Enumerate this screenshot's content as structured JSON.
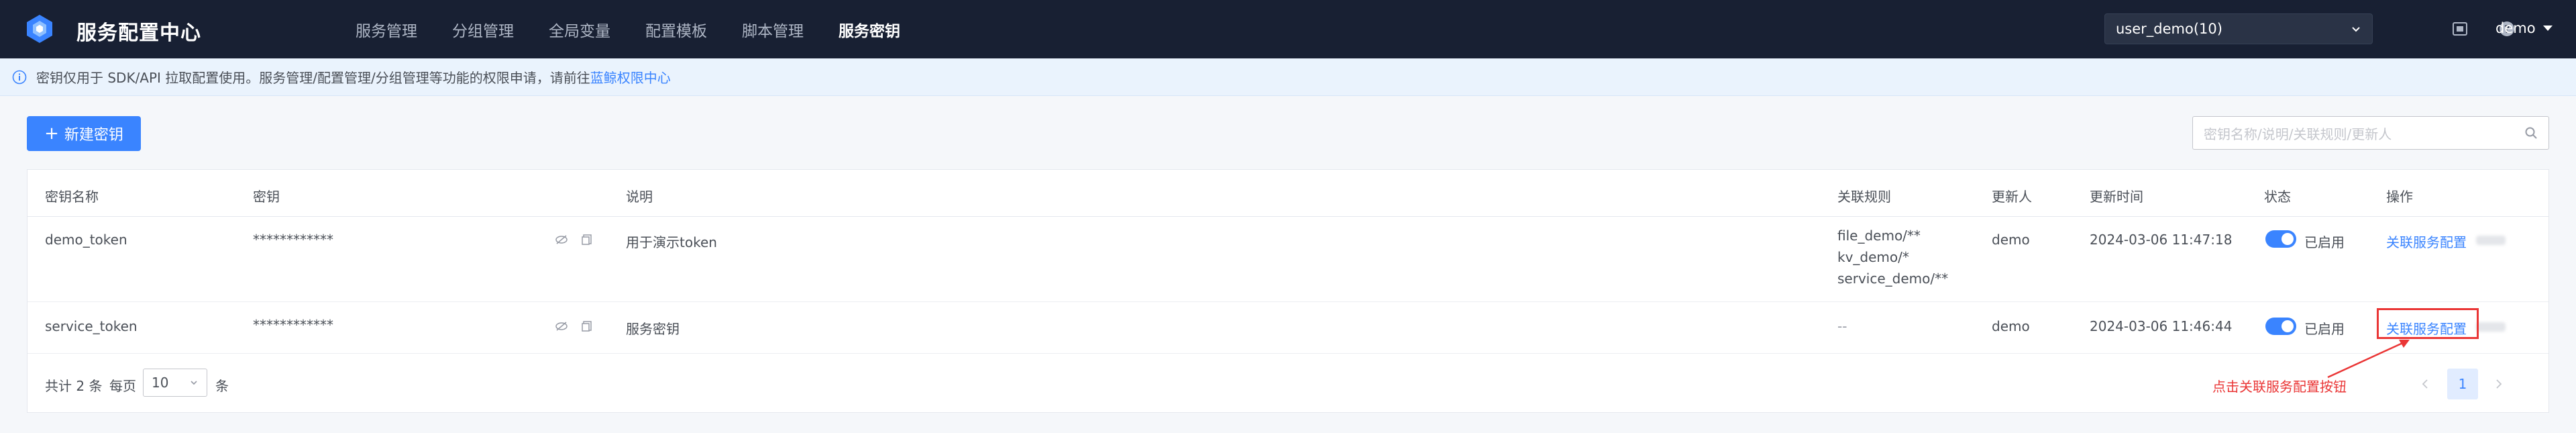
{
  "header": {
    "app_title": "服务配置中心",
    "nav": [
      {
        "label": "服务管理",
        "active": false
      },
      {
        "label": "分组管理",
        "active": false
      },
      {
        "label": "全局变量",
        "active": false
      },
      {
        "label": "配置模板",
        "active": false
      },
      {
        "label": "脚本管理",
        "active": false
      },
      {
        "label": "服务密钥",
        "active": true
      }
    ],
    "business_select": "user_demo(10)",
    "user": "demo"
  },
  "notice": {
    "text": "密钥仅用于 SDK/API 拉取配置使用。服务管理/配置管理/分组管理等功能的权限申请，请前往",
    "link": "蓝鲸权限中心"
  },
  "toolbar": {
    "new_button": "新建密钥",
    "search_placeholder": "密钥名称/说明/关联规则/更新人"
  },
  "table": {
    "columns": [
      "密钥名称",
      "密钥",
      "说明",
      "关联规则",
      "更新人",
      "更新时间",
      "状态",
      "操作"
    ],
    "rows": [
      {
        "name": "demo_token",
        "secret": "************",
        "desc": "用于演示token",
        "rules": [
          "file_demo/**",
          "kv_demo/*",
          "service_demo/**"
        ],
        "updater": "demo",
        "updated_at": "2024-03-06 11:47:18",
        "status": "已启用",
        "action": "关联服务配置"
      },
      {
        "name": "service_token",
        "secret": "************",
        "desc": "服务密钥",
        "rules": [
          "--"
        ],
        "updater": "demo",
        "updated_at": "2024-03-06 11:46:44",
        "status": "已启用",
        "action": "关联服务配置"
      }
    ]
  },
  "pagination": {
    "total_text": "共计 2 条",
    "per_page_label": "每页",
    "per_page": "10",
    "unit": "条",
    "current_page": "1"
  },
  "annotation": "点击关联服务配置按钮",
  "colors": {
    "header_bg": "#182033",
    "primary": "#3a84ff",
    "annotation": "#ea3636"
  }
}
